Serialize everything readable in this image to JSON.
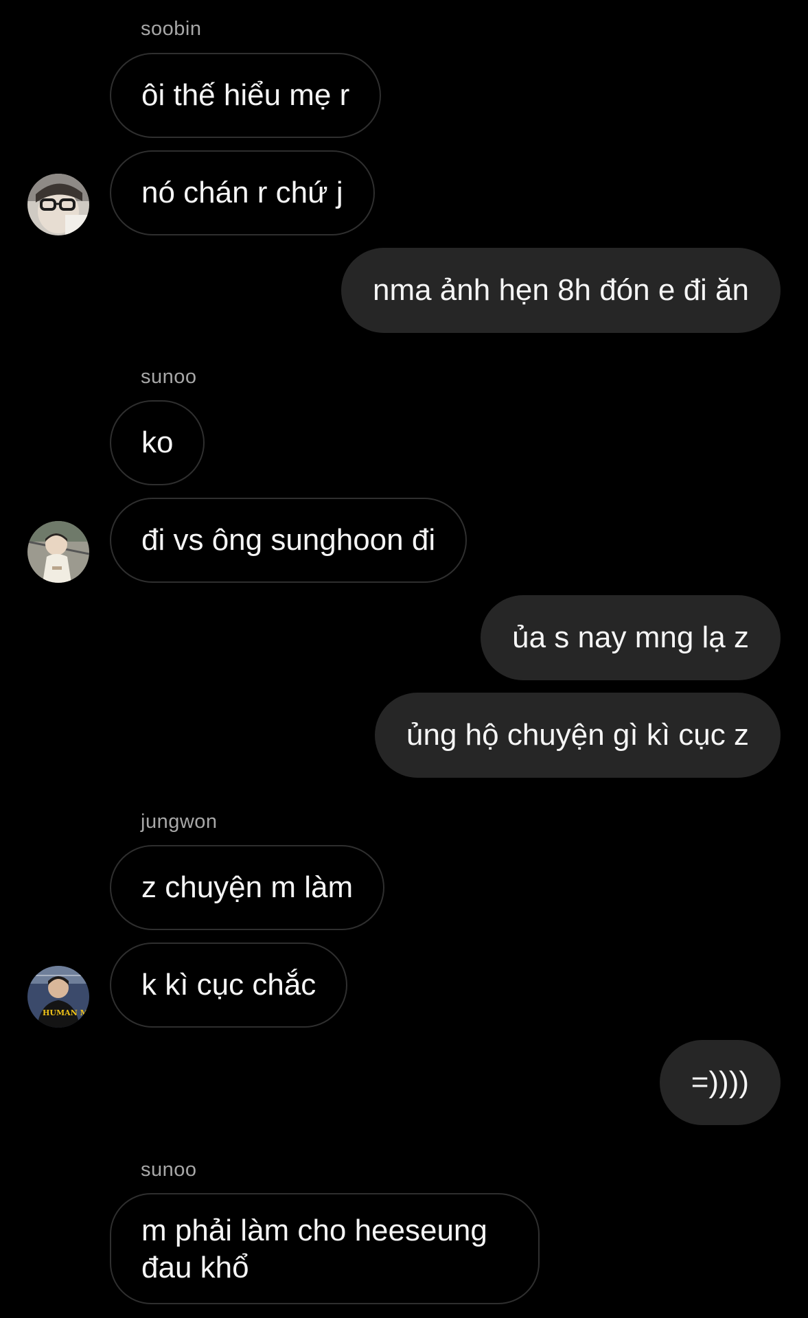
{
  "messages": [
    {
      "sender": "soobin",
      "text": "ôi thế hiểu mẹ r"
    },
    {
      "text": "nó chán r chứ j"
    },
    {
      "text": "nma ảnh hẹn 8h đón e đi ăn"
    },
    {
      "sender": "sunoo",
      "text": "ko"
    },
    {
      "text": "đi vs ông sunghoon đi"
    },
    {
      "text": "ủa s nay mng lạ z"
    },
    {
      "text": "ủng hộ chuyện gì kì cục z"
    },
    {
      "sender": "jungwon",
      "text": "z chuyện m làm"
    },
    {
      "text": "k kì cục chắc"
    },
    {
      "text": "=))))"
    },
    {
      "sender": "sunoo",
      "text": "m phải làm cho heeseung đau khổ"
    }
  ],
  "avatars": {
    "soobin": "avatar-soobin",
    "sunoo": "avatar-sunoo",
    "jungwon": "avatar-jungwon"
  },
  "avatar_text": "HUMAN MADE",
  "colors": {
    "background": "#000000",
    "outgoing_bubble": "#262626",
    "incoming_border": "#2f2f2f",
    "sender_name": "#a8a8a8",
    "text": "#f5f5f5"
  }
}
